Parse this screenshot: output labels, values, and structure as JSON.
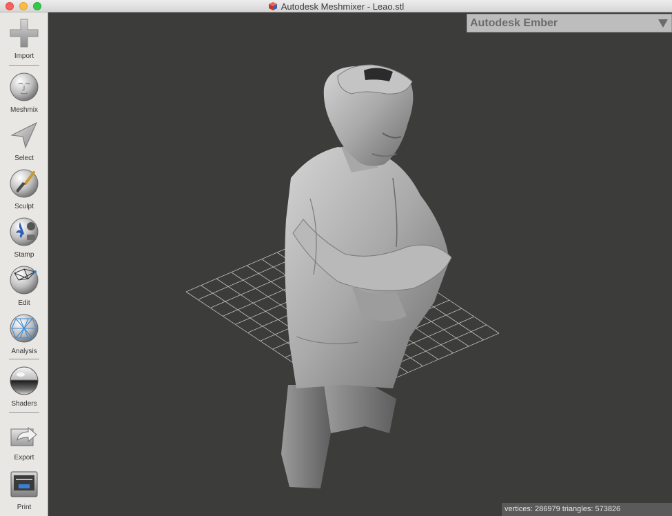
{
  "window": {
    "title": "Autodesk Meshmixer - Leao.stl"
  },
  "sidebar": {
    "tools": [
      {
        "id": "import",
        "label": "Import",
        "icon": "plus-icon"
      },
      {
        "id": "meshmix",
        "label": "Meshmix",
        "icon": "meshmix-face-sphere-icon"
      },
      {
        "id": "select",
        "label": "Select",
        "icon": "arrow-cursor-icon"
      },
      {
        "id": "sculpt",
        "label": "Sculpt",
        "icon": "brush-sphere-icon"
      },
      {
        "id": "stamp",
        "label": "Stamp",
        "icon": "fleur-de-lis-stamp-icon"
      },
      {
        "id": "edit",
        "label": "Edit",
        "icon": "wireframe-sphere-icon"
      },
      {
        "id": "analysis",
        "label": "Analysis",
        "icon": "mesh-sphere-icon"
      },
      {
        "id": "shaders",
        "label": "Shaders",
        "icon": "chrome-sphere-icon"
      },
      {
        "id": "export",
        "label": "Export",
        "icon": "export-arrow-icon"
      },
      {
        "id": "print",
        "label": "Print",
        "icon": "printer-icon"
      }
    ]
  },
  "panel": {
    "title": "Autodesk Ember",
    "icon": "triangle-down-icon"
  },
  "status": {
    "text": "vertices: 286979 triangles: 573826"
  },
  "colors": {
    "viewport_bg": "#3c3c3b",
    "sidebar_bg": "#e9e7e3",
    "model": "#a8a8a8",
    "grid": "#d8d8d8"
  }
}
